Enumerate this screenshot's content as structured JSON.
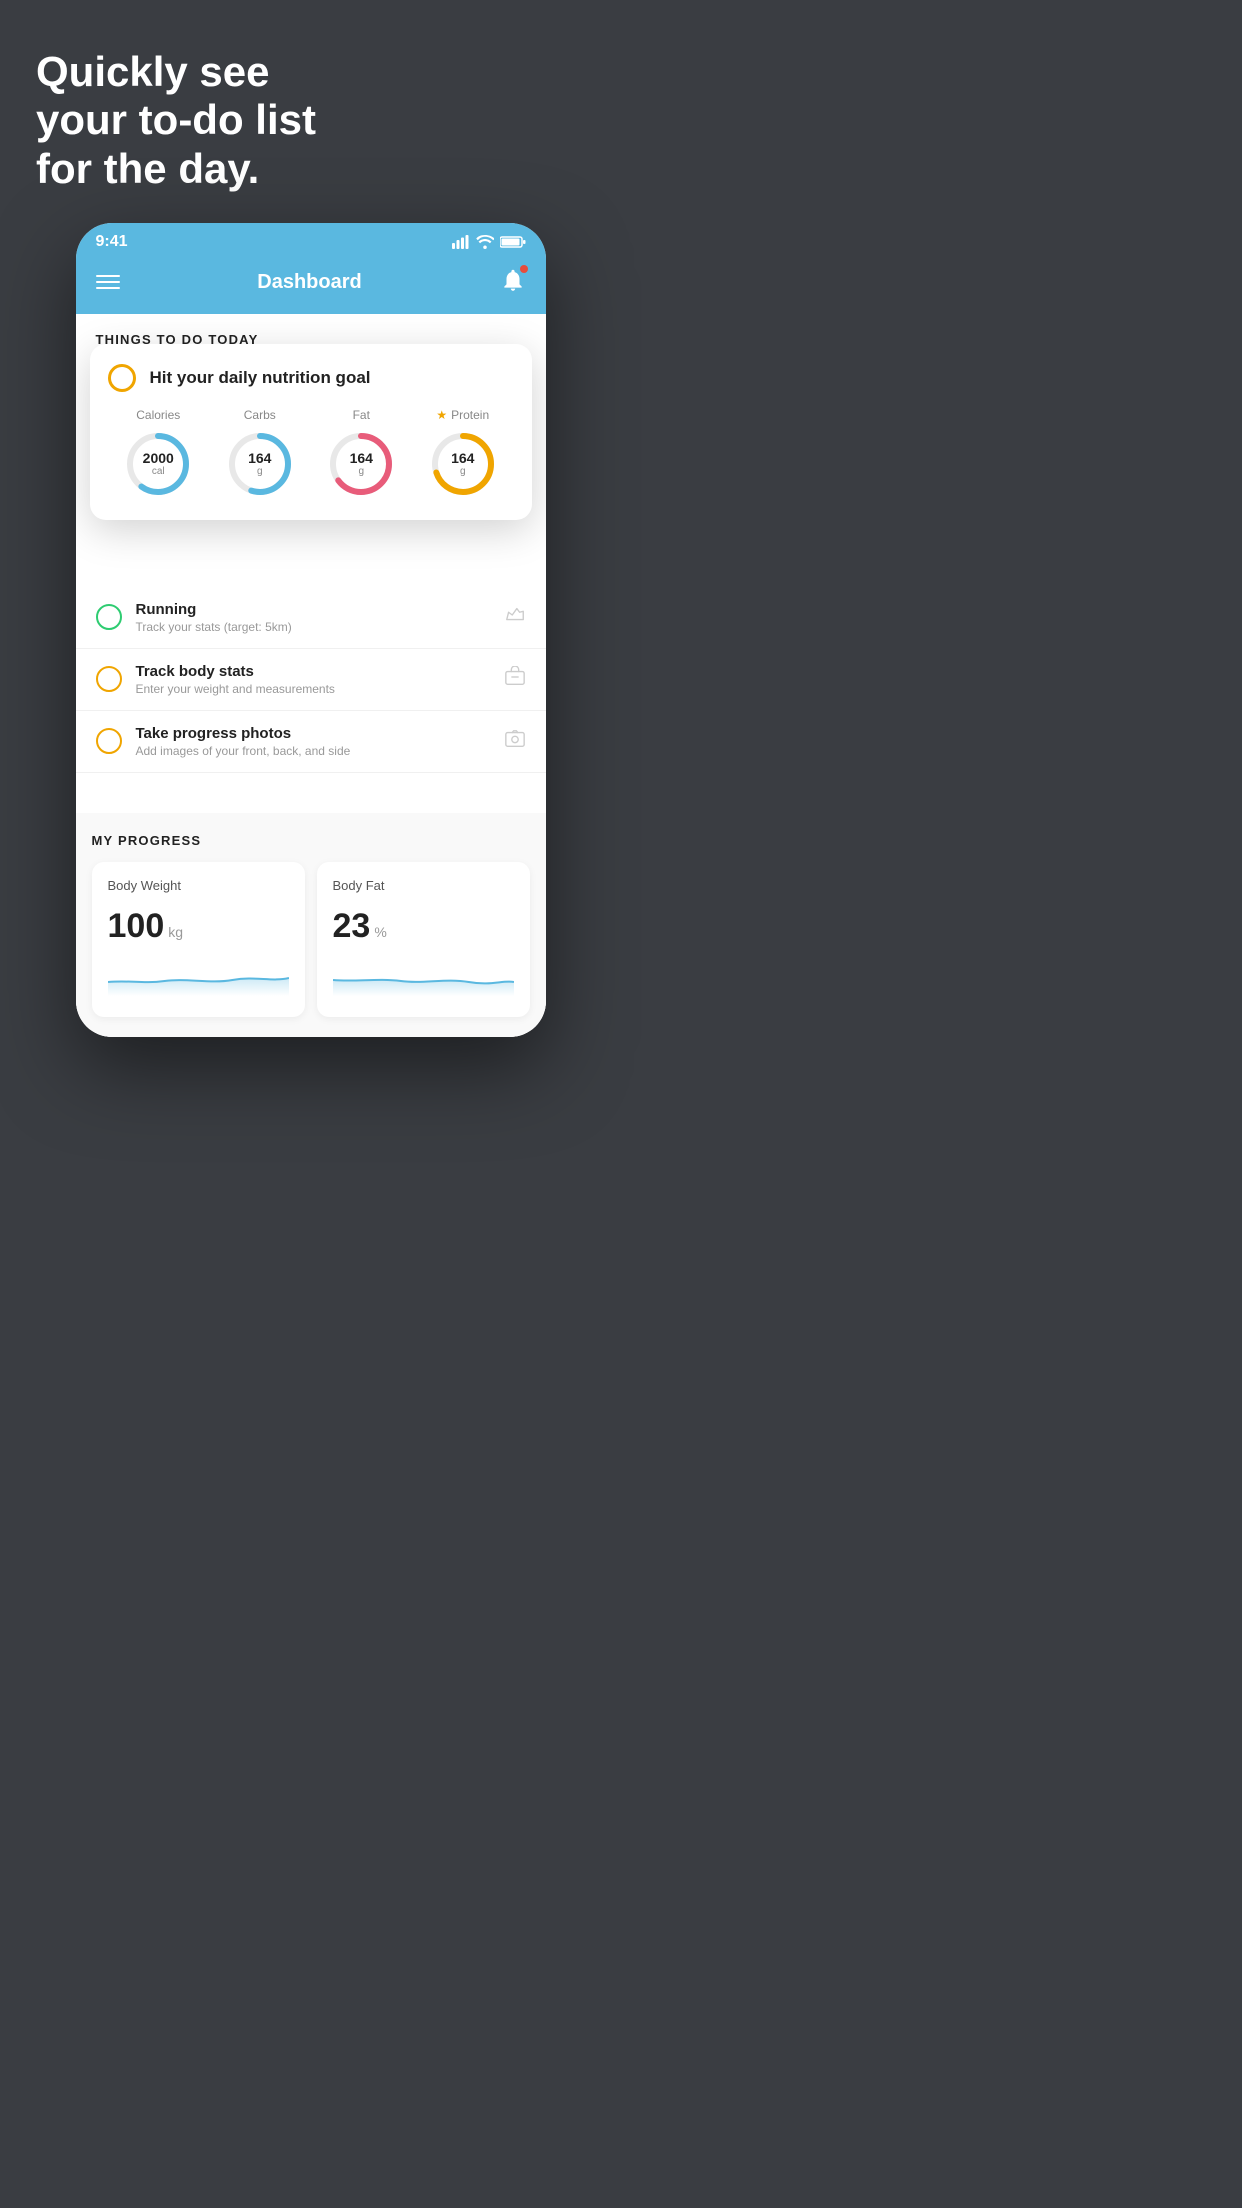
{
  "page": {
    "background_color": "#3a3d42",
    "hero": {
      "line1": "Quickly see",
      "line2": "your to-do list",
      "line3": "for the day."
    },
    "status_bar": {
      "time": "9:41"
    },
    "nav": {
      "title": "Dashboard"
    },
    "things_section": {
      "header": "THINGS TO DO TODAY"
    },
    "floating_card": {
      "checkbox_label": "",
      "title": "Hit your daily nutrition goal",
      "items": [
        {
          "label": "Calories",
          "value": "2000",
          "unit": "cal",
          "color": "#5ab8e0",
          "percent": 60,
          "star": false
        },
        {
          "label": "Carbs",
          "value": "164",
          "unit": "g",
          "color": "#5ab8e0",
          "percent": 55,
          "star": false
        },
        {
          "label": "Fat",
          "value": "164",
          "unit": "g",
          "color": "#e85c7a",
          "percent": 65,
          "star": false
        },
        {
          "label": "Protein",
          "value": "164",
          "unit": "g",
          "color": "#f0a500",
          "percent": 70,
          "star": true
        }
      ]
    },
    "todo_items": [
      {
        "circle_color": "green",
        "title": "Running",
        "subtitle": "Track your stats (target: 5km)",
        "icon": "shoe"
      },
      {
        "circle_color": "yellow",
        "title": "Track body stats",
        "subtitle": "Enter your weight and measurements",
        "icon": "scale"
      },
      {
        "circle_color": "yellow",
        "title": "Take progress photos",
        "subtitle": "Add images of your front, back, and side",
        "icon": "photo"
      }
    ],
    "progress_section": {
      "header": "MY PROGRESS",
      "cards": [
        {
          "title": "Body Weight",
          "value": "100",
          "unit": "kg"
        },
        {
          "title": "Body Fat",
          "value": "23",
          "unit": "%"
        }
      ]
    }
  }
}
